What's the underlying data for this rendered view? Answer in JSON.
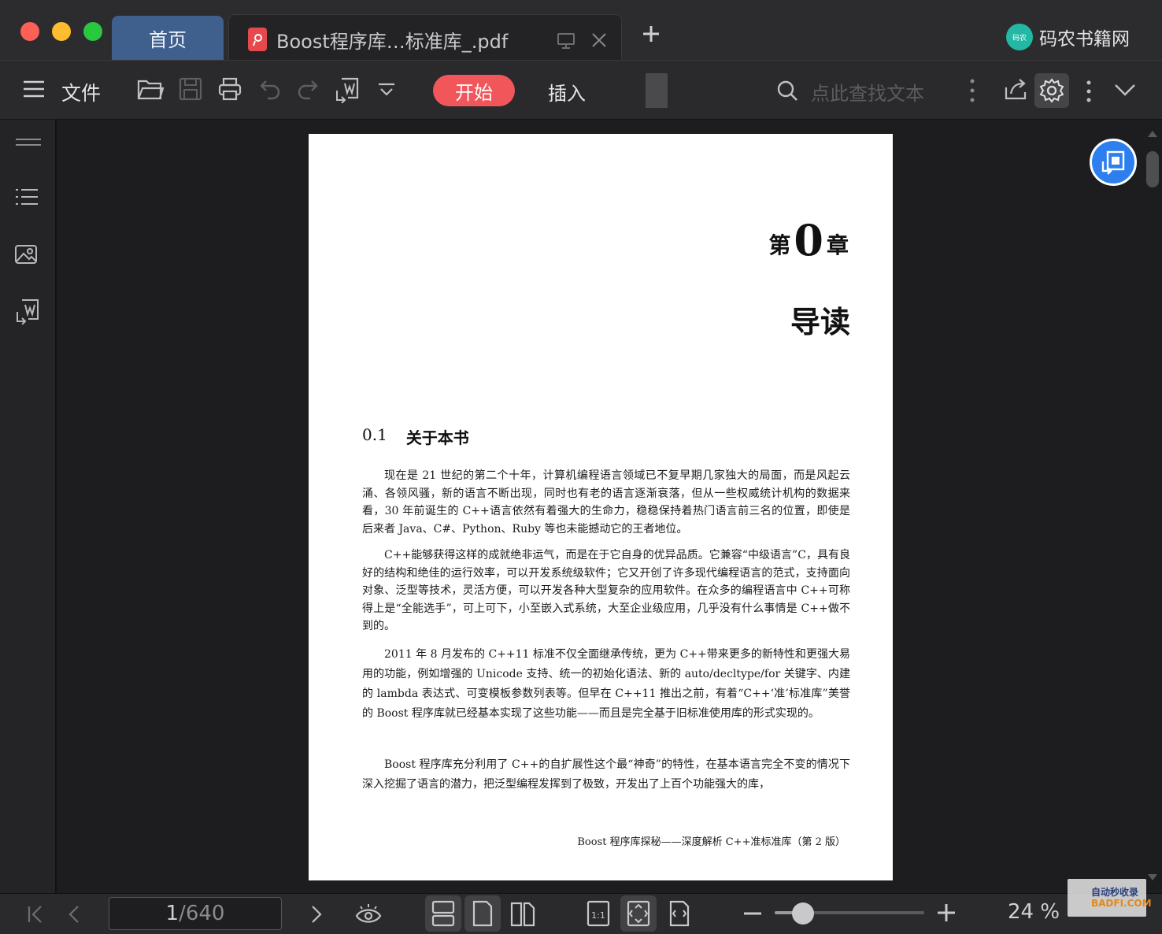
{
  "tabs": {
    "home_label": "首页",
    "doc_title": "Boost程序库…标准库_.pdf"
  },
  "brand": {
    "logo_text": "码农",
    "name": "码农书籍网"
  },
  "toolbar": {
    "file_label": "文件",
    "start_label": "开始",
    "insert_label": "插入",
    "search_placeholder": "点此查找文本"
  },
  "page": {
    "chapter_prefix": "第",
    "chapter_number": "0",
    "chapter_suffix": "章",
    "chapter_title": "导读",
    "section_number": "0.1",
    "section_title": "关于本书",
    "paragraphs": [
      "现在是 21 世纪的第二个十年，计算机编程语言领域已不复早期几家独大的局面，而是风起云涌、各领风骚，新的语言不断出现，同时也有老的语言逐渐衰落，但从一些权威统计机构的数据来看，30 年前诞生的 C++语言依然有着强大的生命力，稳稳保持着热门语言前三名的位置，即使是后来者 Java、C#、Python、Ruby 等也未能撼动它的王者地位。",
      "C++能够获得这样的成就绝非运气，而是在于它自身的优异品质。它兼容“中级语言”C，具有良好的结构和绝佳的运行效率，可以开发系统级软件；它又开创了许多现代编程语言的范式，支持面向对象、泛型等技术，灵活方便，可以开发各种大型复杂的应用软件。在众多的编程语言中 C++可称得上是“全能选手”，可上可下，小至嵌入式系统，大至企业级应用，几乎没有什么事情是 C++做不到的。",
      "2011 年 8 月发布的 C++11 标准不仅全面继承传统，更为 C++带来更多的新特性和更强大易用的功能，例如增强的 Unicode 支持、统一的初始化语法、新的 auto/decltype/for 关键字、内建的 lambda 表达式、可变模板参数列表等。但早在 C++11 推出之前，有着“C++‘准’标准库”美誉的 Boost 程序库就已经基本实现了这些功能——而且是完全基于旧标准使用库的形式实现的。",
      "Boost 程序库充分利用了 C++的自扩展性这个最“神奇”的特性，在基本语言完全不变的情况下深入挖掘了语言的潜力，把泛型编程发挥到了极致，开发出了上百个功能强大的库，"
    ],
    "footer": "Boost 程序库探秘——深度解析 C++准标准库（第 2 版）"
  },
  "status": {
    "current_page": "1",
    "total_pages": "/640",
    "zoom_label": "24 %",
    "zoom_fraction": 0.19
  },
  "watermark": {
    "line1": "自动秒收录",
    "line2": "BADFI.COM"
  },
  "colors": {
    "accent": "#f0565a",
    "tab_home": "#3f5f8c",
    "float_button": "#2d7ff0"
  }
}
